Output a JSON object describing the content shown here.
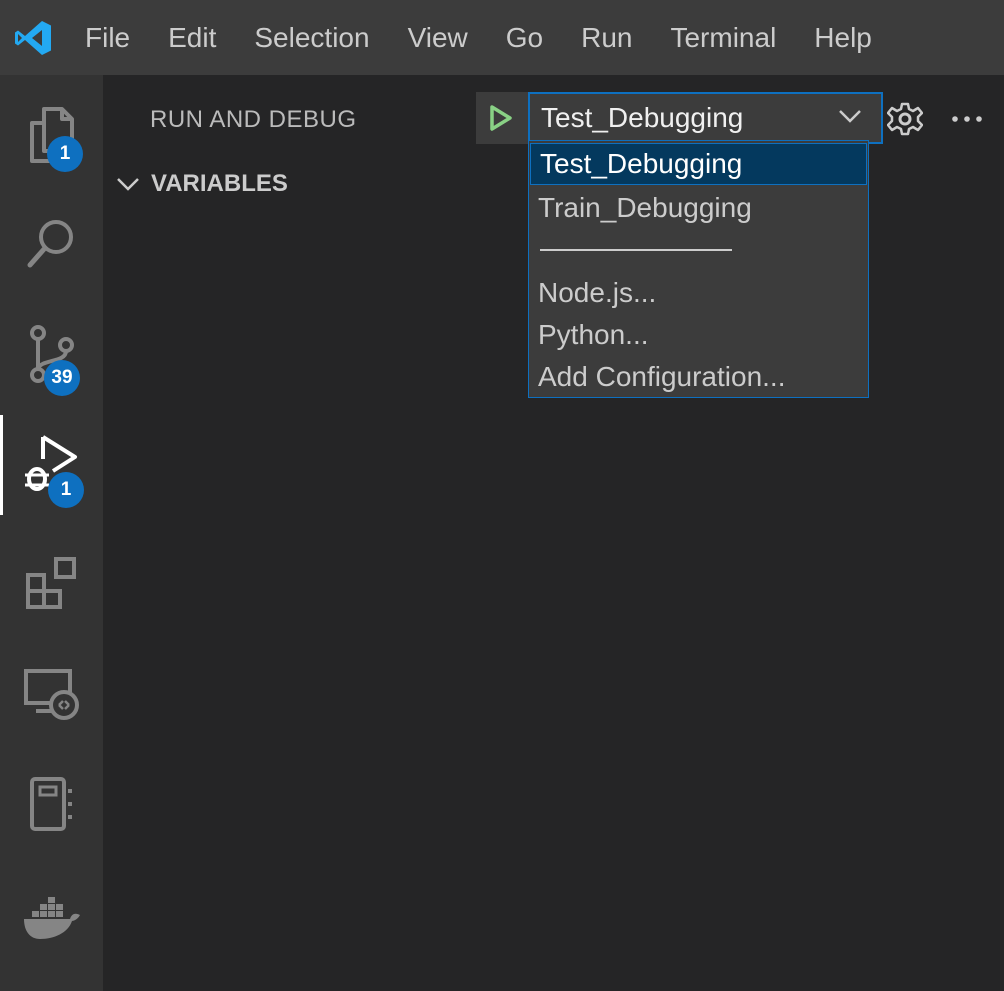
{
  "menu": [
    "File",
    "Edit",
    "Selection",
    "View",
    "Go",
    "Run",
    "Terminal",
    "Help"
  ],
  "activity_bar": {
    "explorer_badge": "1",
    "source_control_badge": "39",
    "run_debug_badge": "1"
  },
  "sidebar": {
    "title": "RUN AND DEBUG",
    "selected_config": "Test_Debugging",
    "variables_label": "VARIABLES"
  },
  "dropdown": {
    "options": [
      "Test_Debugging",
      "Train_Debugging",
      "Node.js...",
      "Python...",
      "Add Configuration..."
    ]
  },
  "colors": {
    "accent": "#0e70c0",
    "run_green": "#89d185",
    "titlebar": "#3c3c3c",
    "activitybar": "#333333",
    "sidebar": "#252526"
  }
}
